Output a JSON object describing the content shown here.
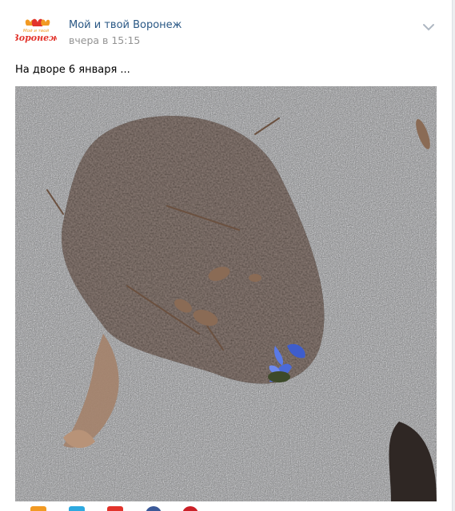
{
  "post": {
    "group_name": "Мой и твой Воронеж",
    "date": "вчера в 15:15",
    "text": "На дворе 6 января ...",
    "logo_text_top": "Мой и твой",
    "logo_text_bottom": "Воронеж"
  },
  "colors": {
    "link": "#2a5885",
    "meta": "#939393",
    "background": "#edeef0",
    "logo_red": "#e2332b",
    "logo_orange": "#f29a23"
  },
  "share_icons": [
    "odnoklassniki-icon",
    "twitter-icon",
    "mail-icon",
    "facebook-icon",
    "pinterest-icon"
  ]
}
